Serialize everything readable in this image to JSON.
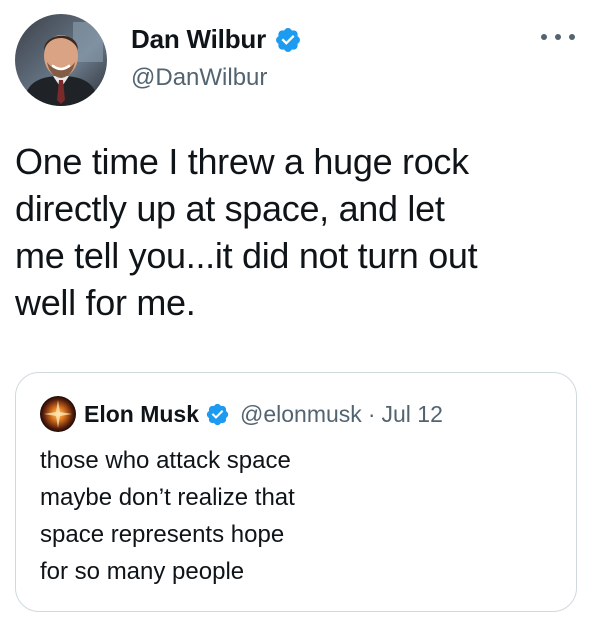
{
  "tweet": {
    "author": {
      "display_name": "Dan Wilbur",
      "handle": "@DanWilbur",
      "verified": true
    },
    "text_lines": [
      "One time I threw a huge rock",
      "directly up at space, and let",
      "me tell you...it did not turn out",
      "well for me."
    ],
    "more_icon": "more-horizontal-icon"
  },
  "quoted_tweet": {
    "author": {
      "display_name": "Elon Musk",
      "handle": "@elonmusk",
      "verified": true
    },
    "separator": "·",
    "date": "Jul 12",
    "text_lines": [
      "those who attack space",
      "maybe don’t realize that",
      "space represents hope",
      "for so many people"
    ]
  },
  "colors": {
    "verified_blue": "#1d9bf0",
    "secondary_text": "#536471",
    "border": "#cfd9de"
  }
}
